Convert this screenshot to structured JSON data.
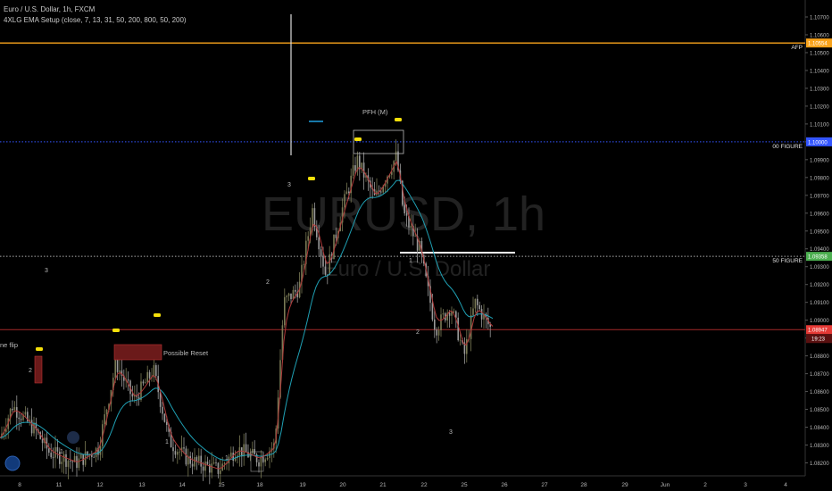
{
  "header": {
    "title": "Euro / U.S. Dollar, 1h, FXCM",
    "indicator": "4XLG EMA Setup (close, 7, 13, 31, 50, 200, 800, 50, 200)"
  },
  "watermark": {
    "symbol": "EURUSD, 1h",
    "name": "Euro / U.S. Dollar"
  },
  "colors": {
    "background": "#000000",
    "up": "#7a7a55",
    "down": "#9a9a9a",
    "ema_fast": "#b03a3a",
    "ema_slow": "#1fa0b4",
    "afp_line": "#f7a21b",
    "level_blue": "#3355ff",
    "level_green": "#4caf50",
    "price_red": "#e53935",
    "marker": "#f5e00a"
  },
  "chart_data": {
    "type": "candlestick",
    "timeframe": "1h",
    "y_axis": {
      "range": [
        1.0815,
        1.1075
      ],
      "ticks": [
        "1.10700",
        "1.10600",
        "1.10500",
        "1.10400",
        "1.10300",
        "1.10200",
        "1.10100",
        "1.10000",
        "1.09900",
        "1.09800",
        "1.09700",
        "1.09600",
        "1.09500",
        "1.09400",
        "1.09300",
        "1.09200",
        "1.09100",
        "1.09000",
        "1.08900",
        "1.08800",
        "1.08700",
        "1.08600",
        "1.08500",
        "1.08400",
        "1.08300",
        "1.08200"
      ]
    },
    "x_axis": {
      "ticks": [
        "8",
        "11",
        "12",
        "13",
        "14",
        "15",
        "18",
        "19",
        "20",
        "21",
        "22",
        "25",
        "26",
        "27",
        "28",
        "29",
        "Jun",
        "2",
        "3",
        "4"
      ]
    },
    "ohlc_close_path": [
      [
        "8",
        1.084
      ],
      [
        "9",
        1.0849
      ],
      [
        "10",
        1.0833
      ],
      [
        "11",
        1.0825
      ],
      [
        "12",
        1.0874
      ],
      [
        "13",
        1.0851
      ],
      [
        "14",
        1.0823
      ],
      [
        "15",
        1.0824
      ],
      [
        "18",
        1.0885
      ],
      [
        "19",
        1.0947
      ],
      [
        "20",
        1.0985
      ],
      [
        "21",
        1.0973
      ],
      [
        "22",
        1.09
      ],
      [
        "25",
        1.0895
      ]
    ],
    "price_labels": [
      {
        "label": "AFP",
        "value": "1.10554"
      },
      {
        "label": "00 FIGURE",
        "value": "1.10000"
      },
      {
        "label": "50 FIGURE",
        "value": "1.09358"
      },
      {
        "label": "",
        "value": "1.08947",
        "sub": "19:23"
      }
    ],
    "annotations": [
      "PFH (M)",
      "Possible Reset",
      "ne flip",
      "1",
      "2",
      "3"
    ]
  }
}
